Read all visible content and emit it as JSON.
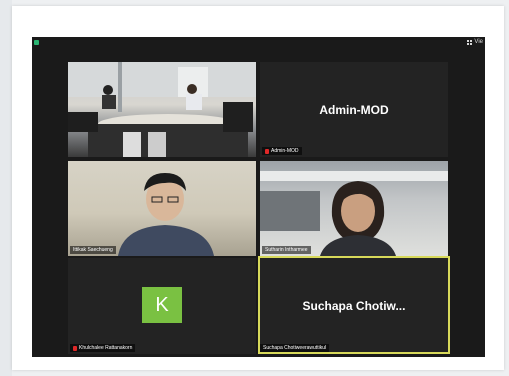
{
  "toolbar": {
    "view_label": "Vie"
  },
  "participants": [
    {
      "name": "",
      "kind": "video-room"
    },
    {
      "name": "Admin-MOD",
      "display": "Admin-MOD",
      "muted": true
    },
    {
      "name": "Ittikak Saechueng",
      "kind": "video-face"
    },
    {
      "name": "Sutharin Intharmee",
      "kind": "video-face"
    },
    {
      "name": "Khulchalee Rattanakorn",
      "avatar_letter": "K",
      "muted": true
    },
    {
      "name": "Suchapa Chotiweerawuttikul",
      "display": "Suchapa  Chotiw...",
      "active_speaker": true
    }
  ],
  "colors": {
    "avatar_green": "#7ac142",
    "active_border": "#d7d95a",
    "mute_red": "#e02828"
  }
}
